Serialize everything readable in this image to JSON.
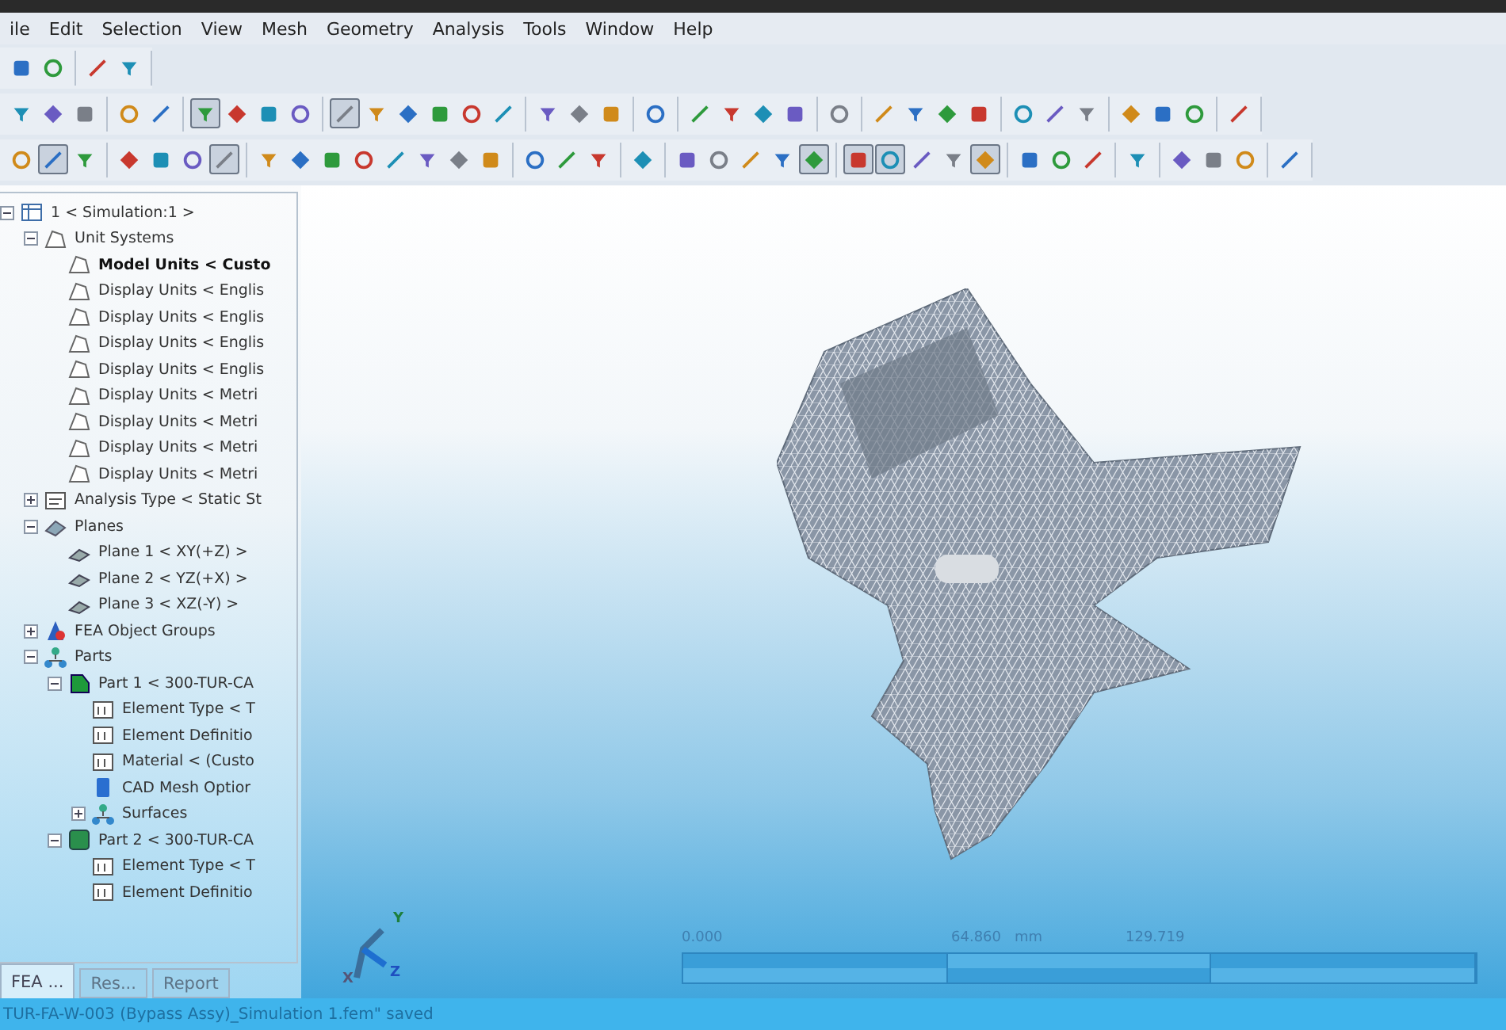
{
  "menu": [
    "ile",
    "Edit",
    "Selection",
    "View",
    "Mesh",
    "Geometry",
    "Analysis",
    "Tools",
    "Window",
    "Help"
  ],
  "toolbars": [
    [
      [
        {
          "pressed": false
        },
        {
          "pressed": false
        }
      ],
      [
        {
          "pressed": false
        },
        {
          "pressed": false
        }
      ]
    ],
    [
      [
        {
          "pressed": false
        },
        {
          "pressed": false
        },
        {
          "pressed": false
        }
      ],
      [
        {
          "pressed": false
        },
        {
          "pressed": false
        }
      ],
      [
        {
          "pressed": true
        },
        {
          "pressed": false
        },
        {
          "pressed": false
        },
        {
          "pressed": false
        }
      ],
      [
        {
          "pressed": true
        },
        {
          "pressed": false
        },
        {
          "pressed": false
        },
        {
          "pressed": false
        },
        {
          "pressed": false
        },
        {
          "pressed": false
        }
      ],
      [
        {
          "pressed": false
        },
        {
          "pressed": false
        },
        {
          "pressed": false
        }
      ],
      [
        {
          "pressed": false
        }
      ],
      [
        {
          "pressed": false
        },
        {
          "pressed": false
        },
        {
          "pressed": false
        },
        {
          "pressed": false
        }
      ],
      [
        {
          "pressed": false
        }
      ],
      [
        {
          "pressed": false
        },
        {
          "pressed": false
        },
        {
          "pressed": false
        },
        {
          "pressed": false
        }
      ],
      [
        {
          "pressed": false
        },
        {
          "pressed": false
        },
        {
          "pressed": false
        }
      ],
      [
        {
          "pressed": false
        },
        {
          "pressed": false
        },
        {
          "pressed": false
        }
      ],
      [
        {
          "pressed": false
        }
      ]
    ],
    [
      [
        {
          "pressed": false
        },
        {
          "pressed": true
        },
        {
          "pressed": false
        }
      ],
      [
        {
          "pressed": false
        },
        {
          "pressed": false
        },
        {
          "pressed": false
        },
        {
          "pressed": true
        }
      ],
      [
        {
          "pressed": false
        },
        {
          "pressed": false
        },
        {
          "pressed": false
        },
        {
          "pressed": false
        },
        {
          "pressed": false
        },
        {
          "pressed": false
        },
        {
          "pressed": false
        },
        {
          "pressed": false
        }
      ],
      [
        {
          "pressed": false
        },
        {
          "pressed": false
        },
        {
          "pressed": false
        }
      ],
      [
        {
          "pressed": false
        }
      ],
      [
        {
          "pressed": false
        },
        {
          "pressed": false
        },
        {
          "pressed": false
        },
        {
          "pressed": false
        },
        {
          "pressed": true
        }
      ],
      [
        {
          "pressed": true
        },
        {
          "pressed": true
        },
        {
          "pressed": false
        },
        {
          "pressed": false
        },
        {
          "pressed": true
        }
      ],
      [
        {
          "pressed": false
        },
        {
          "pressed": false
        },
        {
          "pressed": false
        }
      ],
      [
        {
          "pressed": false
        }
      ],
      [
        {
          "pressed": false
        },
        {
          "pressed": false
        },
        {
          "pressed": false
        }
      ],
      [
        {
          "pressed": false
        }
      ]
    ]
  ],
  "tree": [
    {
      "label": "1 < Simulation:1 >",
      "kind": "simulation",
      "bold": false,
      "expanded": true,
      "children": [
        {
          "label": "Unit Systems",
          "kind": "units",
          "bold": false,
          "expanded": true,
          "children": [
            {
              "label": "Model Units < Custo",
              "kind": "unit",
              "bold": true
            },
            {
              "label": "Display Units < Englis",
              "kind": "unit",
              "bold": false
            },
            {
              "label": "Display Units < Englis",
              "kind": "unit",
              "bold": false
            },
            {
              "label": "Display Units < Englis",
              "kind": "unit",
              "bold": false
            },
            {
              "label": "Display Units < Englis",
              "kind": "unit",
              "bold": false
            },
            {
              "label": "Display Units < Metri",
              "kind": "unit",
              "bold": false
            },
            {
              "label": "Display Units < Metri",
              "kind": "unit",
              "bold": false
            },
            {
              "label": "Display Units < Metri",
              "kind": "unit",
              "bold": false
            },
            {
              "label": "Display Units < Metri",
              "kind": "unit",
              "bold": false
            }
          ]
        },
        {
          "label": "Analysis Type < Static St",
          "kind": "analysis",
          "bold": false,
          "expanded": false
        },
        {
          "label": "Planes",
          "kind": "planes",
          "bold": false,
          "expanded": true,
          "children": [
            {
              "label": "Plane 1 < XY(+Z) >",
              "kind": "plane",
              "bold": false
            },
            {
              "label": "Plane 2 < YZ(+X) >",
              "kind": "plane",
              "bold": false
            },
            {
              "label": "Plane 3 < XZ(-Y) >",
              "kind": "plane",
              "bold": false
            }
          ]
        },
        {
          "label": "FEA Object Groups",
          "kind": "groups",
          "bold": false,
          "expanded": false
        },
        {
          "label": "Parts",
          "kind": "parts",
          "bold": false,
          "expanded": true,
          "children": [
            {
              "label": "Part 1 < 300-TUR-CA",
              "kind": "part",
              "bold": false,
              "expanded": true,
              "children": [
                {
                  "label": "Element Type < T",
                  "kind": "property",
                  "bold": false
                },
                {
                  "label": "Element Definitio",
                  "kind": "property",
                  "bold": false
                },
                {
                  "label": "Material < (Custo",
                  "kind": "property",
                  "bold": false
                },
                {
                  "label": "CAD Mesh Optior",
                  "kind": "options",
                  "bold": false
                },
                {
                  "label": "Surfaces",
                  "kind": "parts",
                  "bold": false,
                  "expanded": false
                }
              ]
            },
            {
              "label": "Part 2 < 300-TUR-CA",
              "kind": "part2",
              "bold": false,
              "expanded": true,
              "children": [
                {
                  "label": "Element Type < T",
                  "kind": "property",
                  "bold": false
                },
                {
                  "label": "Element Definitio",
                  "kind": "property",
                  "bold": false
                }
              ]
            }
          ]
        }
      ]
    }
  ],
  "panel_tabs": [
    {
      "label": "FEA ...",
      "selected": true
    },
    {
      "label": "Res...",
      "selected": false
    },
    {
      "label": "Report",
      "selected": false
    }
  ],
  "axes": [
    {
      "label": "Y"
    },
    {
      "label": "Z"
    },
    {
      "label": "X"
    }
  ],
  "scale": {
    "ticks": [
      "0.000",
      "64.860",
      "129.719"
    ],
    "unit": "mm"
  },
  "status_bar": "TUR-FA-W-003 (Bypass Assy)_Simulation 1.fem\" saved"
}
